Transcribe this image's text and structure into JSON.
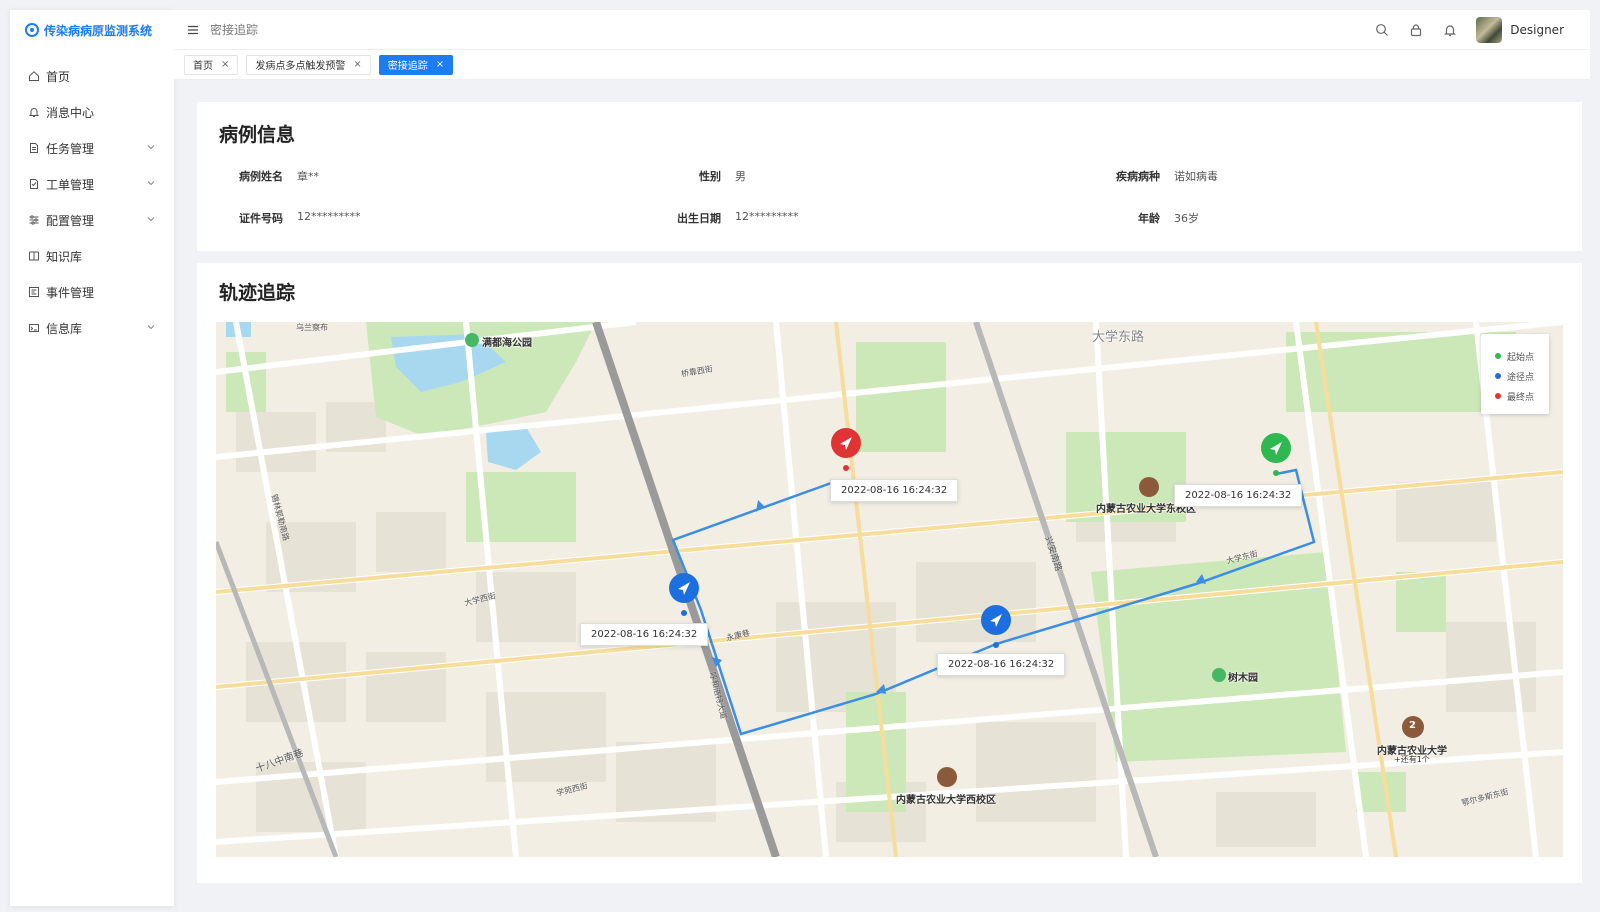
{
  "app": {
    "title": "传染病病原监测系统"
  },
  "sidebar": {
    "items": [
      {
        "label": "首页",
        "icon": "home-icon",
        "expandable": false
      },
      {
        "label": "消息中心",
        "icon": "bell-icon",
        "expandable": false
      },
      {
        "label": "任务管理",
        "icon": "task-icon",
        "expandable": true
      },
      {
        "label": "工单管理",
        "icon": "ticket-icon",
        "expandable": true
      },
      {
        "label": "配置管理",
        "icon": "sliders-icon",
        "expandable": true
      },
      {
        "label": "知识库",
        "icon": "book-icon",
        "expandable": false
      },
      {
        "label": "事件管理",
        "icon": "event-icon",
        "expandable": false
      },
      {
        "label": "信息库",
        "icon": "database-icon",
        "expandable": true
      }
    ]
  },
  "header": {
    "breadcrumb": "密接追踪",
    "username": "Designer"
  },
  "tabs": [
    {
      "label": "首页",
      "active": false
    },
    {
      "label": "发病点多点触发预警",
      "active": false
    },
    {
      "label": "密接追踪",
      "active": true
    }
  ],
  "case_info": {
    "title": "病例信息",
    "fields": [
      {
        "label": "病例姓名",
        "value": "章**"
      },
      {
        "label": "性别",
        "value": "男"
      },
      {
        "label": "疾病病种",
        "value": "诺如病毒"
      },
      {
        "label": "证件号码",
        "value": "12*********"
      },
      {
        "label": "出生日期",
        "value": "12*********"
      },
      {
        "label": "年龄",
        "value": "36岁"
      }
    ]
  },
  "tracking": {
    "title": "轨迹追踪",
    "legend": [
      {
        "label": "起始点",
        "color": "#2fb84f"
      },
      {
        "label": "途径点",
        "color": "#1d6fe0"
      },
      {
        "label": "最终点",
        "color": "#e03434"
      }
    ],
    "points": [
      {
        "type": "start",
        "time": "2022-08-16 16:24:32"
      },
      {
        "type": "via",
        "time": "2022-08-16 16:24:32"
      },
      {
        "type": "via",
        "time": "2022-08-16 16:24:32"
      },
      {
        "type": "end",
        "time": "2022-08-16 16:24:32"
      }
    ],
    "map_labels": {
      "park1": "满都海公园",
      "park2": "树木园",
      "road_top": "大学东路",
      "uni1": "内蒙古农业大学东校区",
      "uni2": "内蒙古农业大学西校区",
      "uni3": "内蒙古农业大学",
      "uni3_more": "+还有1个",
      "badge": "2",
      "roads": [
        "乌兰察布",
        "锡林郭勒南路",
        "十八中南巷",
        "大学西街",
        "永康巷",
        "呼和浩特大道",
        "兴安南路",
        "大学东街",
        "鄂尔多斯东街",
        "桥靠西街",
        "学苑西街"
      ]
    }
  },
  "colors": {
    "accent": "#1d7cf2",
    "route": "#3a8ee6"
  }
}
